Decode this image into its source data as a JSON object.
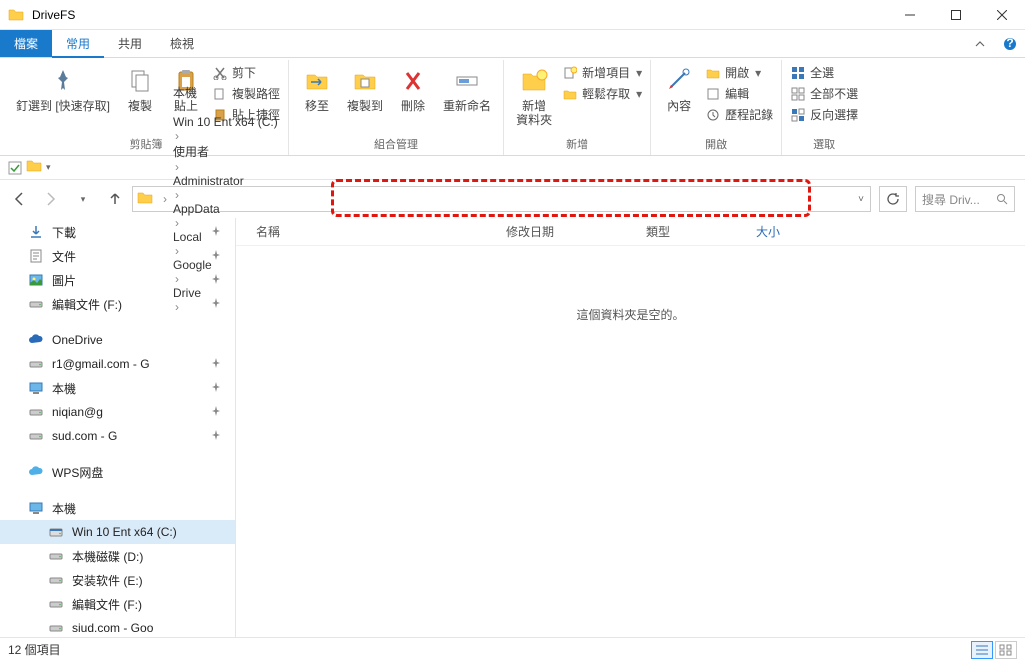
{
  "window": {
    "title": "DriveFS"
  },
  "tabs": {
    "file": "檔案",
    "home": "常用",
    "share": "共用",
    "view": "檢視"
  },
  "ribbon": {
    "clipboard": {
      "pin": "釘選到 [快速存取]",
      "copy": "複製",
      "paste": "貼上",
      "cut": "剪下",
      "copy_path": "複製路徑",
      "paste_shortcut": "貼上捷徑",
      "label": "剪貼簿"
    },
    "organize": {
      "move": "移至",
      "copy_to": "複製到",
      "delete": "刪除",
      "rename": "重新命名",
      "label": "組合管理"
    },
    "new": {
      "new_folder": "新增\n資料夾",
      "new_item": "新增項目",
      "easy_save": "輕鬆存取",
      "label": "新增"
    },
    "open": {
      "properties": "內容",
      "open": "開啟",
      "edit": "編輯",
      "history": "歷程記錄",
      "label": "開啟"
    },
    "select": {
      "select_all": "全選",
      "select_none": "全部不選",
      "invert": "反向選擇",
      "label": "選取"
    }
  },
  "breadcrumb": [
    "本機",
    "Win 10 Ent x64 (C:)",
    "使用者",
    "Administrator",
    "AppData",
    "Local",
    "Google",
    "Drive"
  ],
  "search": {
    "placeholder": "搜尋 Driv..."
  },
  "columns": {
    "name": "名稱",
    "date": "修改日期",
    "type": "類型",
    "size": "大小"
  },
  "empty": "這個資料夾是空的。",
  "sidebar": [
    {
      "icon": "download",
      "label": "下載",
      "pin": true
    },
    {
      "icon": "doc",
      "label": "文件",
      "pin": true
    },
    {
      "icon": "pictures",
      "label": "圖片",
      "pin": true
    },
    {
      "icon": "drive",
      "label": "編輯文件 (F:)",
      "pin": true
    },
    {
      "icon": "onedrive",
      "label": "OneDrive"
    },
    {
      "icon": "drive",
      "label": "r‎‎‎‎‎‎‎‎‎1@gmail.com - G",
      "pin": true
    },
    {
      "icon": "pc",
      "label": "本機",
      "pin": true
    },
    {
      "icon": "drive",
      "label": "ni‎‎‎‎‎‎‎‎‎‎‎‎‎‎‎qian@g‎",
      "pin": true
    },
    {
      "icon": "drive",
      "label": "s‎‎‎‎‎‎‎‎‎‎‎‎‎ud.com - G",
      "pin": true
    },
    {
      "icon": "wps",
      "label": "WPS网盘"
    },
    {
      "icon": "pc",
      "label": "本機"
    },
    {
      "icon": "disk",
      "label": "Win 10 Ent x64 (C:)",
      "indent": true,
      "selected": true
    },
    {
      "icon": "drive",
      "label": "本機磁碟 (D:)",
      "indent": true
    },
    {
      "icon": "drive",
      "label": "安装软件 (E:)",
      "indent": true
    },
    {
      "icon": "drive",
      "label": "編輯文件 (F:)",
      "indent": true
    },
    {
      "icon": "drive",
      "label": "si‎‎‎‎‎‎‎‎‎‎‎‎‎ud.com - Goo‎",
      "indent": true
    }
  ],
  "status": {
    "count": "12 個項目"
  }
}
